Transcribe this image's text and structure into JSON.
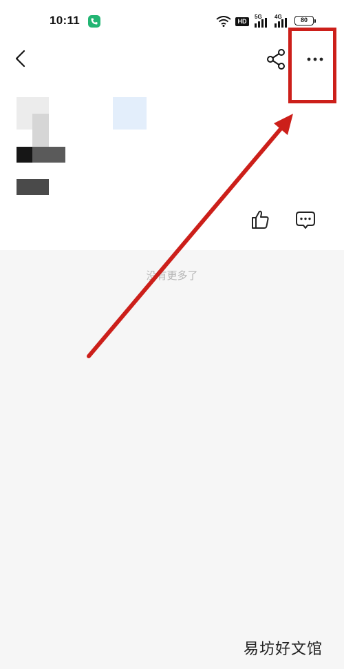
{
  "status_bar": {
    "time": "10:11",
    "hd": "HD",
    "network_1": "5G",
    "network_2": "4G",
    "battery": "80"
  },
  "toolbar": {
    "back_icon": "chevron-left-icon",
    "share_icon": "share-icon",
    "more_icon": "ellipsis-icon"
  },
  "actions": {
    "like_icon": "thumbs-up-icon",
    "comment_icon": "comment-icon"
  },
  "feed": {
    "end_text": "没有更多了"
  },
  "annotation": {
    "color": "#cc1f1a"
  },
  "watermark": "易坊好文馆"
}
